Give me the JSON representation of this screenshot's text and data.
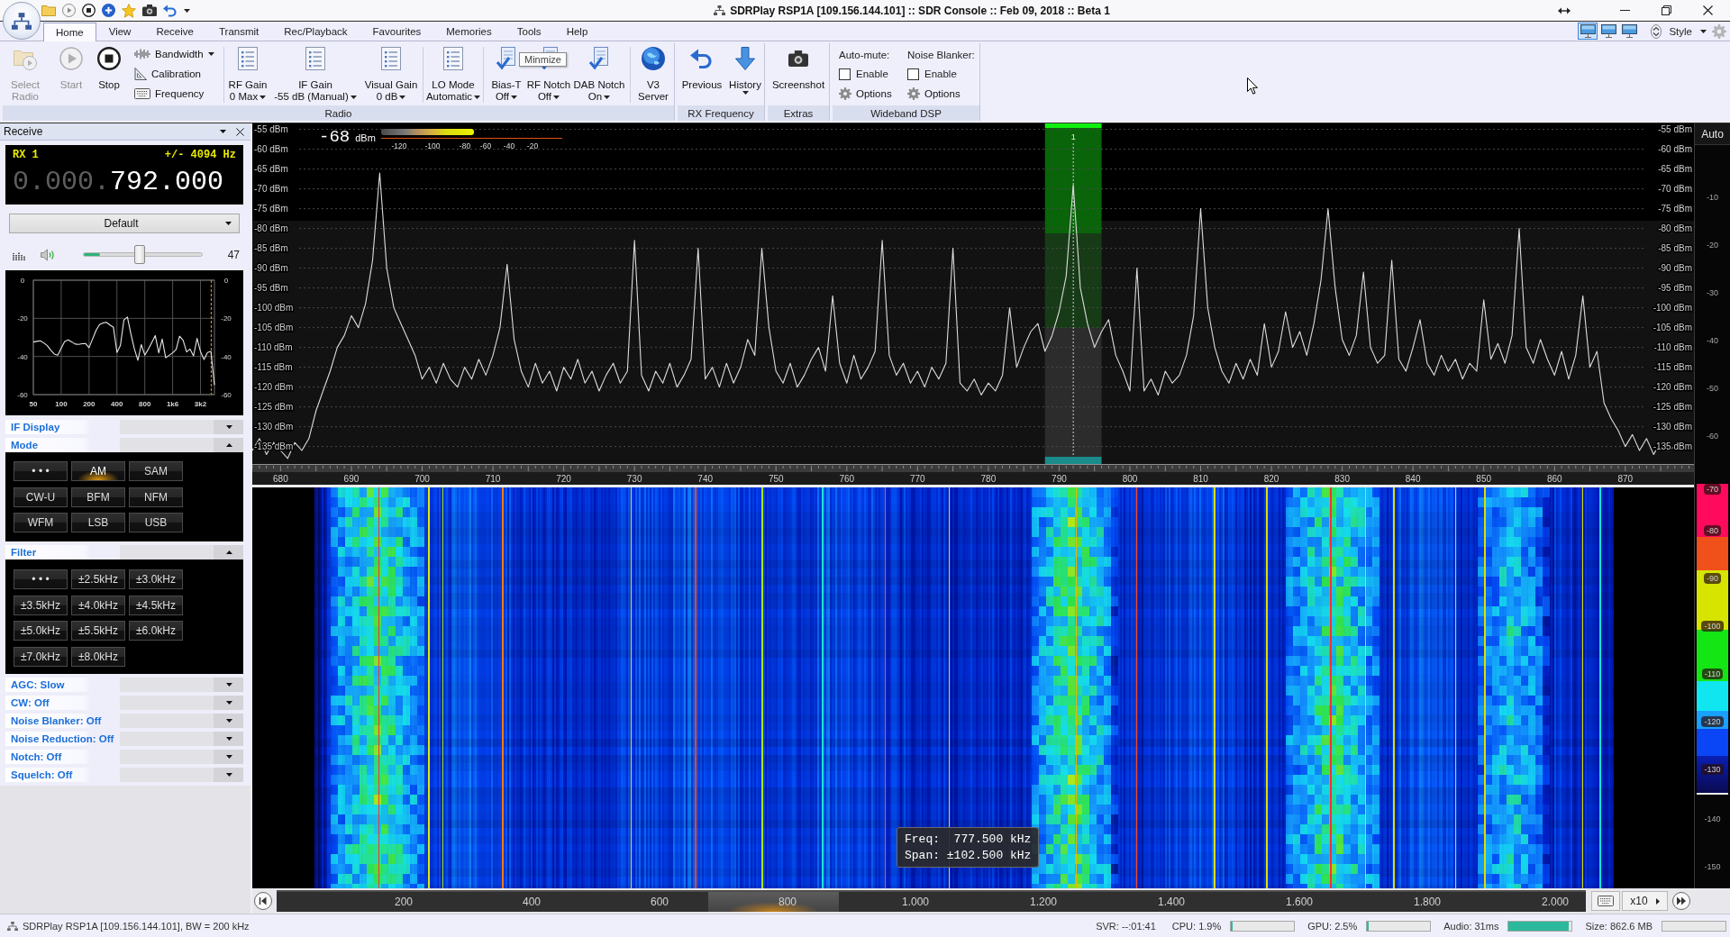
{
  "window": {
    "title": "SDRPlay RSP1A [109.156.144.101] :: SDR Console :: Feb 09, 2018 :: Beta 1"
  },
  "ribbon": {
    "tabs": [
      {
        "label": "Home",
        "selected": true
      },
      {
        "label": "View",
        "selected": false
      },
      {
        "label": "Receive",
        "selected": false
      },
      {
        "label": "Transmit",
        "selected": false
      },
      {
        "label": "Rec/Playback",
        "selected": false
      },
      {
        "label": "Favourites",
        "selected": false
      },
      {
        "label": "Memories",
        "selected": false
      },
      {
        "label": "Tools",
        "selected": false
      },
      {
        "label": "Help",
        "selected": false
      }
    ],
    "layout_buttons": [
      {
        "selected": true
      },
      {
        "selected": false
      },
      {
        "selected": false
      }
    ],
    "style_menu": "Style",
    "radio": {
      "title": "Radio",
      "select_radio": {
        "label": "Select Radio",
        "disabled": true
      },
      "start": {
        "label": "Start",
        "disabled": true
      },
      "stop": {
        "label": "Stop",
        "disabled": false
      },
      "bandwidth": "Bandwidth",
      "calibration": "Calibration",
      "frequency": "Frequency",
      "rf_gain": {
        "label": "RF Gain",
        "value": "0 Max"
      },
      "if_gain": {
        "label": "IF Gain",
        "value": "-55 dB (Manual)"
      },
      "visual_gain": {
        "label": "Visual Gain",
        "value": "0 dB"
      },
      "lo_mode": {
        "label": "LO Mode",
        "value": "Automatic"
      },
      "bias_t": {
        "label": "Bias-T",
        "value": "Off"
      },
      "rf_notch": {
        "label": "RF Notch",
        "value": "Off"
      },
      "dab_notch": {
        "label": "DAB Notch",
        "value": "On"
      },
      "v3_server": {
        "label": "V3 Server"
      }
    },
    "rx_frequency": {
      "title": "RX Frequency",
      "previous": "Previous",
      "history": "History"
    },
    "extras": {
      "title": "Extras",
      "screenshot": "Screenshot"
    },
    "wideband_dsp": {
      "title": "Wideband DSP",
      "auto_mute": {
        "title": "Auto-mute:",
        "enable": {
          "label": "Enable",
          "checked": false
        },
        "options": "Options"
      },
      "noise_blanker": {
        "title": "Noise Blanker:",
        "enable": {
          "label": "Enable",
          "checked": false
        },
        "options": "Options"
      }
    },
    "tooltip": "Minmize"
  },
  "receive_panel": {
    "title": "Receive",
    "rx_display": {
      "receiver": "RX 1",
      "offset": "+/- 4094 Hz",
      "frequency_prefix": "0.000.",
      "frequency": "792.000"
    },
    "preset": "Default",
    "volume": {
      "level": 0.47,
      "reading": "47",
      "meter": {
        "level": 0.14
      }
    },
    "audio_spectrum": {
      "chart_data": {
        "type": "line",
        "categories": [
          "50",
          null,
          null,
          null,
          null,
          null,
          null,
          null,
          "100",
          null,
          null,
          null,
          null,
          null,
          null,
          null,
          "200",
          null,
          null,
          null,
          null,
          null,
          null,
          null,
          "400",
          null,
          null,
          null,
          null,
          null,
          null,
          null,
          "800",
          null,
          null,
          null,
          null,
          null,
          null,
          null,
          "1k6",
          null,
          null,
          null,
          null,
          null,
          null,
          null,
          "3k2",
          null,
          null,
          null,
          null
        ],
        "series": [
          {
            "color": "#e8e8e8",
            "values": [
              -32.4,
              -32.1,
              -31.8,
              -32.9,
              -34.3,
              -36.7,
              -38.7,
              -39.3,
              -35.6,
              -32.1,
              -31.3,
              -32.3,
              -33.5,
              -33.7,
              -33.3,
              -33.2,
              -35.4,
              -30.9,
              -26.3,
              -23.3,
              -22.4,
              -22.1,
              -23.5,
              -24.7,
              -37.9,
              -34.3,
              -20.9,
              -19.3,
              -28,
              -36,
              -42,
              -33.8,
              -39.3,
              -36.2,
              -32.7,
              -29,
              -38.1,
              -30.9,
              -40.7,
              -39.4,
              -38.1,
              -36.3,
              -29.4,
              -31.5,
              -37.6,
              -36.1,
              -39.7,
              -30.5,
              -37.4,
              -41.6,
              -37.9,
              -37.3,
              -55
            ]
          }
        ],
        "ylim": [
          -60,
          0
        ],
        "yticks": [
          0,
          -20,
          -40,
          -60
        ],
        "grid": true
      },
      "right_axis": [
        "0",
        "-20",
        "-40",
        "-60"
      ]
    },
    "sections": [
      {
        "title": "IF Display",
        "expanded": false
      },
      {
        "title": "Mode",
        "expanded": true,
        "buttons": [
          {
            "label": "• • •",
            "selected": false
          },
          {
            "label": "AM",
            "selected": true
          },
          {
            "label": "SAM",
            "selected": false
          },
          {
            "label": "CW-U",
            "selected": false
          },
          {
            "label": "BFM",
            "selected": false
          },
          {
            "label": "NFM",
            "selected": false
          },
          {
            "label": "WFM",
            "selected": false
          },
          {
            "label": "LSB",
            "selected": false
          },
          {
            "label": "USB",
            "selected": false
          }
        ]
      },
      {
        "title": "Filter",
        "expanded": true,
        "buttons": [
          {
            "label": "• • •",
            "selected": false
          },
          {
            "label": "±2.5kHz",
            "selected": false
          },
          {
            "label": "±3.0kHz",
            "selected": false
          },
          {
            "label": "±3.5kHz",
            "selected": false
          },
          {
            "label": "±4.0kHz",
            "selected": false
          },
          {
            "label": "±4.5kHz",
            "selected": false
          },
          {
            "label": "±5.0kHz",
            "selected": false
          },
          {
            "label": "±5.5kHz",
            "selected": false
          },
          {
            "label": "±6.0kHz",
            "selected": false
          },
          {
            "label": "±7.0kHz",
            "selected": false
          },
          {
            "label": "±8.0kHz",
            "selected": false
          }
        ]
      },
      {
        "title": "AGC: Slow",
        "expanded": false
      },
      {
        "title": "CW: Off",
        "expanded": false
      },
      {
        "title": "Noise Blanker: Off",
        "expanded": false
      },
      {
        "title": "Noise Reduction: Off",
        "expanded": false
      },
      {
        "title": "Notch: Off",
        "expanded": false
      },
      {
        "title": "Squelch: Off",
        "expanded": false
      }
    ]
  },
  "spectrum": {
    "signal_reading": "-68",
    "signal_unit": "dBm",
    "signal_meter": {
      "level": 0.51,
      "scale": [
        "-120",
        "-100",
        "-80",
        "-60",
        "-40",
        "-20"
      ]
    },
    "chart_data": {
      "type": "line",
      "x": [
        676,
        677,
        678,
        679,
        680,
        681,
        682,
        683,
        684,
        685,
        686,
        687,
        688,
        689,
        690,
        691,
        692,
        693,
        694,
        695,
        696,
        697,
        698,
        699,
        700,
        701,
        702,
        703,
        704,
        705,
        706,
        707,
        708,
        709,
        710,
        711,
        712,
        713,
        714,
        715,
        716,
        717,
        718,
        719,
        720,
        721,
        722,
        723,
        724,
        725,
        726,
        727,
        728,
        729,
        730,
        731,
        732,
        733,
        734,
        735,
        736,
        737,
        738,
        739,
        740,
        741,
        742,
        743,
        744,
        745,
        746,
        747,
        748,
        749,
        750,
        751,
        752,
        753,
        754,
        755,
        756,
        757,
        758,
        759,
        760,
        761,
        762,
        763,
        764,
        765,
        766,
        767,
        768,
        769,
        770,
        771,
        772,
        773,
        774,
        775,
        776,
        777,
        778,
        779,
        780,
        781,
        782,
        783,
        784,
        785,
        786,
        787,
        788,
        789,
        790,
        791,
        792,
        793,
        794,
        795,
        796,
        797,
        798,
        799,
        800,
        801,
        802,
        803,
        804,
        805,
        806,
        807,
        808,
        809,
        810,
        811,
        812,
        813,
        814,
        815,
        816,
        817,
        818,
        819,
        820,
        821,
        822,
        823,
        824,
        825,
        826,
        827,
        828,
        829,
        830,
        831,
        832,
        833,
        834,
        835,
        836,
        837,
        838,
        839,
        840,
        841,
        842,
        843,
        844,
        845,
        846,
        847,
        848,
        849,
        850,
        851,
        852,
        853,
        854,
        855,
        856,
        857,
        858,
        859,
        860,
        861,
        862,
        863,
        864,
        865,
        866,
        867,
        868,
        869,
        870,
        871,
        872,
        873,
        874,
        875,
        876,
        877
      ],
      "series": [
        {
          "color": "#dcdcdc",
          "values": [
            -136,
            -133,
            -137,
            -134,
            -136,
            -138,
            -134,
            -136,
            -133,
            -126,
            -121,
            -116,
            -110,
            -107,
            -102,
            -105,
            -99,
            -88,
            -66,
            -90,
            -100,
            -104,
            -108,
            -112,
            -118,
            -115,
            -119,
            -114,
            -118,
            -120,
            -115,
            -118,
            -113,
            -117,
            -112,
            -105,
            -89,
            -108,
            -116,
            -120,
            -114,
            -119,
            -116,
            -121,
            -115,
            -118,
            -113,
            -119,
            -116,
            -121,
            -117,
            -114,
            -119,
            -116,
            -83,
            -117,
            -121,
            -116,
            -119,
            -114,
            -120,
            -117,
            -113,
            -85,
            -118,
            -115,
            -120,
            -114,
            -119,
            -115,
            -108,
            -112,
            -85,
            -105,
            -116,
            -119,
            -114,
            -120,
            -117,
            -113,
            -110,
            -116,
            -97,
            -114,
            -119,
            -112,
            -118,
            -115,
            -111,
            -83,
            -112,
            -117,
            -114,
            -119,
            -116,
            -120,
            -115,
            -118,
            -114,
            -85,
            -119,
            -121,
            -118,
            -122,
            -119,
            -121,
            -117,
            -100,
            -115,
            -110,
            -106,
            -104,
            -111,
            -107,
            -101,
            -92,
            -69,
            -95,
            -104,
            -110,
            -106,
            -103,
            -112,
            -116,
            -121,
            -90,
            -121,
            -118,
            -122,
            -116,
            -119,
            -117,
            -112,
            -102,
            -75,
            -100,
            -110,
            -116,
            -119,
            -114,
            -118,
            -113,
            -117,
            -104,
            -115,
            -111,
            -101,
            -110,
            -106,
            -112,
            -104,
            -93,
            -75,
            -95,
            -108,
            -112,
            -107,
            -91,
            -110,
            -114,
            -112,
            -88,
            -113,
            -116,
            -110,
            -103,
            -114,
            -117,
            -112,
            -116,
            -113,
            -118,
            -114,
            -116,
            -98,
            -113,
            -109,
            -114,
            -107,
            -80,
            -110,
            -114,
            -108,
            -113,
            -117,
            -111,
            -118,
            -112,
            -97,
            -115,
            -111,
            -124,
            -128,
            -131,
            -135,
            -132,
            -136,
            -133,
            -137,
            -134,
            -136,
            -135
          ]
        }
      ],
      "xlim": [
        676,
        879.7
      ],
      "ylim": [
        -139.4,
        -53.5
      ],
      "xticks": [
        680,
        690,
        700,
        710,
        720,
        730,
        740,
        750,
        760,
        770,
        780,
        790,
        800,
        810,
        820,
        830,
        840,
        850,
        860,
        870
      ],
      "yticks": [
        {
          "value": -55,
          "label": "-55 dBm"
        },
        {
          "value": -60,
          "label": "-60 dBm"
        },
        {
          "value": -65,
          "label": "-65 dBm"
        },
        {
          "value": -70,
          "label": "-70 dBm"
        },
        {
          "value": -75,
          "label": "-75 dBm"
        },
        {
          "value": -80,
          "label": "-80 dBm"
        },
        {
          "value": -85,
          "label": "-85 dBm"
        },
        {
          "value": -90,
          "label": "-90 dBm"
        },
        {
          "value": -95,
          "label": "-95 dBm"
        },
        {
          "value": -100,
          "label": "-100 dBm"
        },
        {
          "value": -105,
          "label": "-105 dBm"
        },
        {
          "value": -110,
          "label": "-110 dBm"
        },
        {
          "value": -115,
          "label": "-115 dBm"
        },
        {
          "value": -120,
          "label": "-120 dBm"
        },
        {
          "value": -125,
          "label": "-125 dBm"
        },
        {
          "value": -130,
          "label": "-130 dBm"
        },
        {
          "value": -135,
          "label": "-135 dBm"
        }
      ],
      "grid": true,
      "bands": [
        {
          "axis": "x",
          "from": 788,
          "to": 796,
          "label": "1"
        }
      ],
      "ref_lines": [
        {
          "axis": "x",
          "value": 792
        }
      ]
    },
    "right_axis": [
      "-55 dBm",
      "-60 dBm",
      "-65 dBm",
      "-70 dBm",
      "-75 dBm",
      "-80 dBm",
      "-85 dBm",
      "-90 dBm",
      "-95 dBm",
      "-100 dBm",
      "-105 dBm",
      "-110 dBm",
      "-115 dBm",
      "-120 dBm",
      "-125 dBm",
      "-130 dBm",
      "-135 dBm"
    ]
  },
  "color_scale": {
    "auto_button": "Auto",
    "labels": [
      "-10",
      "-20",
      "-30",
      "-40",
      "-50",
      "-60"
    ],
    "bar_labels": [
      "-70",
      "-80",
      "-90",
      "-100",
      "-110",
      "-120",
      "-130"
    ],
    "lower_labels": [
      "-140",
      "-150"
    ]
  },
  "waterfall": {
    "tooltip": {
      "freq": "Freq:  777.500 kHz",
      "span": "Span: ±102.500 kHz"
    }
  },
  "overview": {
    "labels": [
      "200",
      "400",
      "600",
      "800",
      "1.000",
      "1.200",
      "1.400",
      "1.600",
      "1.800",
      "2.000"
    ],
    "zoom": "x10"
  },
  "status_bar": {
    "connection": "SDRPlay RSP1A [109.156.144.101], BW = 200 kHz",
    "server_time": "SVR: --:01:41",
    "meters": [
      {
        "label": "CPU: 1.9%",
        "level": 0.02
      },
      {
        "label": "GPU: 2.5%",
        "level": 0.03
      },
      {
        "label": "Audio: 31ms",
        "level": 0.95
      },
      {
        "label": "Size: 862.6 MB",
        "level": 0
      }
    ]
  }
}
